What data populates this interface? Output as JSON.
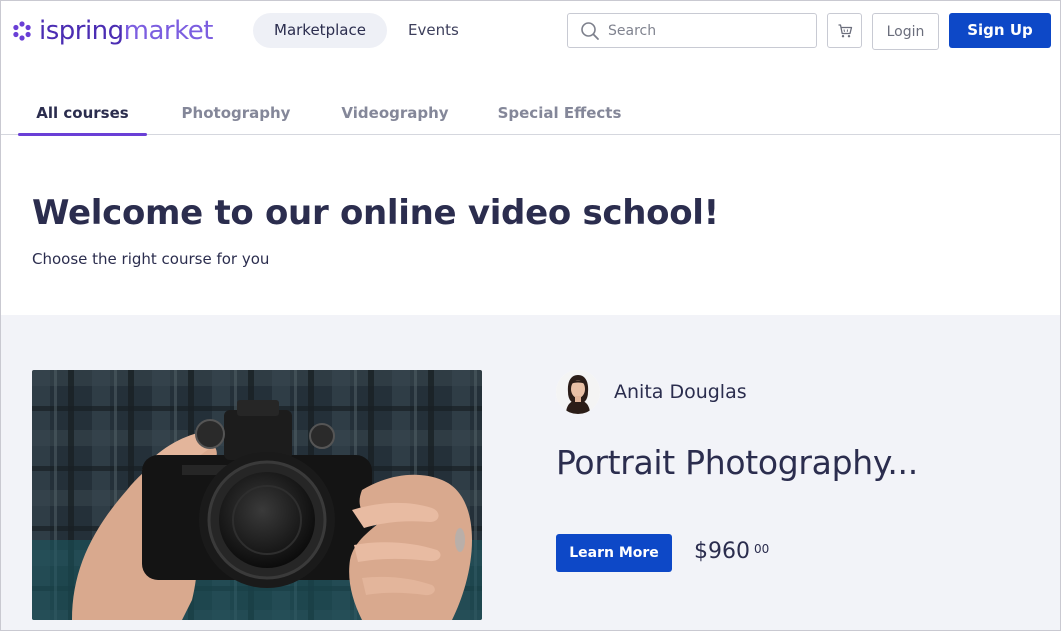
{
  "brand": {
    "name_part1": "ispring",
    "name_part2": "market",
    "accent_color": "#6a3fd6",
    "primary_button_color": "#0d48c7"
  },
  "header": {
    "nav": [
      {
        "label": "Marketplace",
        "active": true
      },
      {
        "label": "Events",
        "active": false
      }
    ],
    "search": {
      "placeholder": "Search",
      "value": "",
      "icon": "search-icon"
    },
    "cart_icon": "cart-icon",
    "login_label": "Login",
    "signup_label": "Sign Up"
  },
  "tabs": [
    {
      "label": "All courses",
      "active": true
    },
    {
      "label": "Photography",
      "active": false
    },
    {
      "label": "Videography",
      "active": false
    },
    {
      "label": "Special Effects",
      "active": false
    }
  ],
  "welcome": {
    "title": "Welcome to our online video school!",
    "subtitle": "Choose the right course for you"
  },
  "featured_course": {
    "author_name": "Anita Douglas",
    "title": "Portrait Photography...",
    "cta_label": "Learn More",
    "price_main": "$960",
    "price_cents": "00"
  }
}
